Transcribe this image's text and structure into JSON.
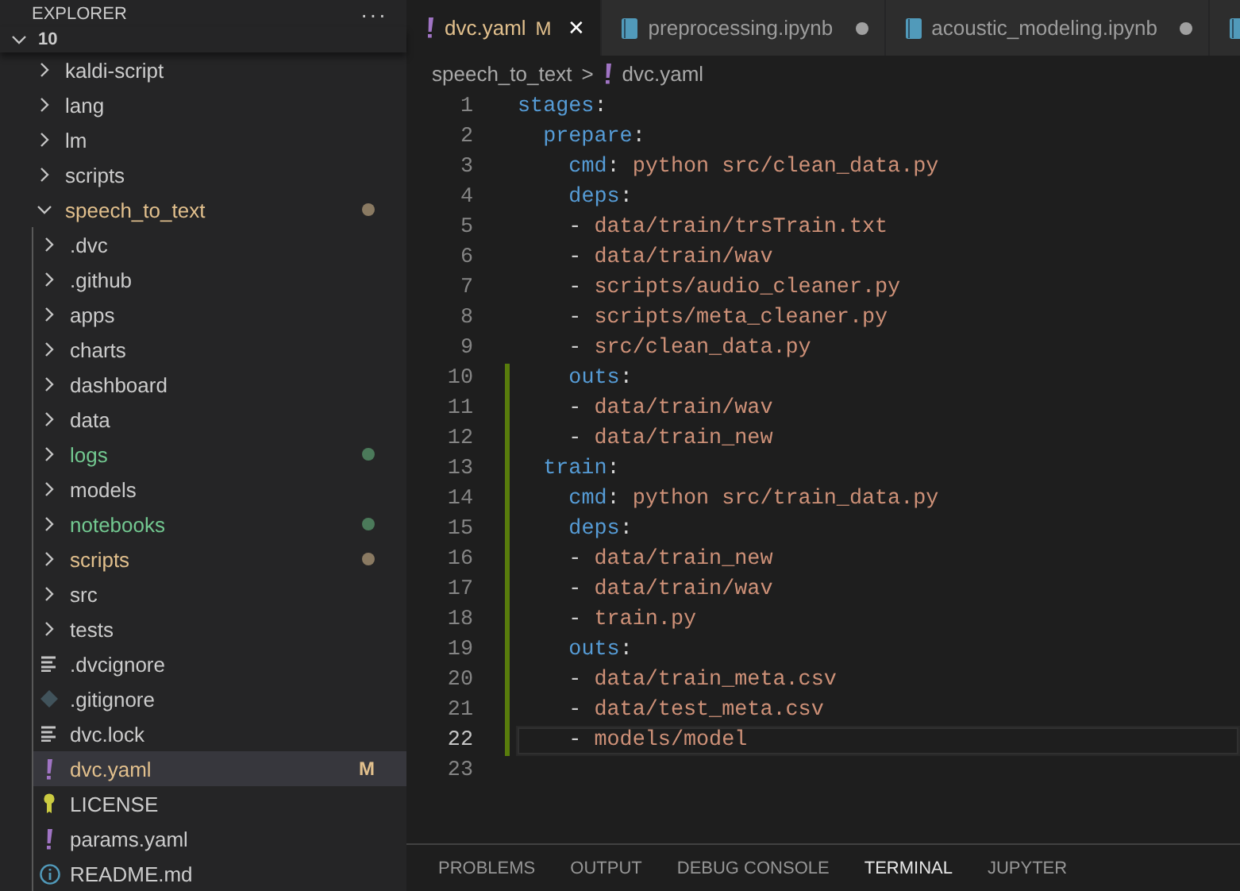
{
  "sidebar": {
    "title": "EXPLORER",
    "more": "···",
    "workspace": {
      "label": "10",
      "expanded": true
    },
    "tree": [
      {
        "name": "kaldi-script",
        "kind": "folder",
        "expanded": false,
        "modified": false,
        "untracked": false,
        "selected": false
      },
      {
        "name": "lang",
        "kind": "folder",
        "expanded": false,
        "modified": false,
        "untracked": false,
        "selected": false
      },
      {
        "name": "lm",
        "kind": "folder",
        "expanded": false,
        "modified": false,
        "untracked": false,
        "selected": false
      },
      {
        "name": "scripts",
        "kind": "folder",
        "expanded": false,
        "modified": false,
        "untracked": false,
        "selected": false
      },
      {
        "name": "speech_to_text",
        "kind": "folder",
        "expanded": true,
        "modified": true,
        "untracked": false,
        "selected": false,
        "children": [
          {
            "name": ".dvc",
            "kind": "folder",
            "expanded": false,
            "modified": false,
            "untracked": false,
            "selected": false
          },
          {
            "name": ".github",
            "kind": "folder",
            "expanded": false,
            "modified": false,
            "untracked": false,
            "selected": false
          },
          {
            "name": "apps",
            "kind": "folder",
            "expanded": false,
            "modified": false,
            "untracked": false,
            "selected": false
          },
          {
            "name": "charts",
            "kind": "folder",
            "expanded": false,
            "modified": false,
            "untracked": false,
            "selected": false
          },
          {
            "name": "dashboard",
            "kind": "folder",
            "expanded": false,
            "modified": false,
            "untracked": false,
            "selected": false
          },
          {
            "name": "data",
            "kind": "folder",
            "expanded": false,
            "modified": false,
            "untracked": false,
            "selected": false
          },
          {
            "name": "logs",
            "kind": "folder",
            "expanded": false,
            "modified": false,
            "untracked": true,
            "selected": false
          },
          {
            "name": "models",
            "kind": "folder",
            "expanded": false,
            "modified": false,
            "untracked": false,
            "selected": false
          },
          {
            "name": "notebooks",
            "kind": "folder",
            "expanded": false,
            "modified": false,
            "untracked": true,
            "selected": false
          },
          {
            "name": "scripts",
            "kind": "folder",
            "expanded": false,
            "modified": true,
            "untracked": false,
            "selected": false
          },
          {
            "name": "src",
            "kind": "folder",
            "expanded": false,
            "modified": false,
            "untracked": false,
            "selected": false
          },
          {
            "name": "tests",
            "kind": "folder",
            "expanded": false,
            "modified": false,
            "untracked": false,
            "selected": false
          },
          {
            "name": ".dvcignore",
            "kind": "text",
            "modified": false,
            "untracked": false,
            "selected": false
          },
          {
            "name": ".gitignore",
            "kind": "git",
            "modified": false,
            "untracked": false,
            "selected": false
          },
          {
            "name": "dvc.lock",
            "kind": "text",
            "modified": false,
            "untracked": false,
            "selected": false
          },
          {
            "name": "dvc.yaml",
            "kind": "yaml",
            "modified": true,
            "untracked": false,
            "badge": "M",
            "selected": true
          },
          {
            "name": "LICENSE",
            "kind": "license",
            "modified": false,
            "untracked": false,
            "selected": false
          },
          {
            "name": "params.yaml",
            "kind": "yaml",
            "modified": false,
            "untracked": false,
            "selected": false
          },
          {
            "name": "README.md",
            "kind": "info",
            "modified": false,
            "untracked": false,
            "selected": false
          }
        ]
      }
    ]
  },
  "tabs": [
    {
      "label": "dvc.yaml",
      "kind": "yaml",
      "selected": true,
      "badge": "M",
      "close": "✕",
      "dirty": false
    },
    {
      "label": "preprocessing.ipynb",
      "kind": "notebook",
      "selected": false,
      "dirty": true
    },
    {
      "label": "acoustic_modeling.ipynb",
      "kind": "notebook",
      "selected": false,
      "dirty": true
    },
    {
      "kind": "notebook",
      "selected": false,
      "dirty": false
    }
  ],
  "breadcrumb": {
    "folder": "speech_to_text",
    "separator": ">",
    "file": "dvc.yaml"
  },
  "code": [
    {
      "number": "1",
      "text": "stages:",
      "changed": false,
      "current": false
    },
    {
      "number": "2",
      "text": "  prepare:",
      "changed": false,
      "current": false
    },
    {
      "number": "3",
      "text": "    cmd: python src/clean_data.py",
      "changed": false,
      "current": false
    },
    {
      "number": "4",
      "text": "    deps:",
      "changed": false,
      "current": false
    },
    {
      "number": "5",
      "text": "    - data/train/trsTrain.txt",
      "changed": false,
      "current": false
    },
    {
      "number": "6",
      "text": "    - data/train/wav",
      "changed": false,
      "current": false
    },
    {
      "number": "7",
      "text": "    - scripts/audio_cleaner.py",
      "changed": false,
      "current": false
    },
    {
      "number": "8",
      "text": "    - scripts/meta_cleaner.py",
      "changed": false,
      "current": false
    },
    {
      "number": "9",
      "text": "    - src/clean_data.py",
      "changed": false,
      "current": false
    },
    {
      "number": "10",
      "text": "    outs:",
      "changed": true,
      "current": false
    },
    {
      "number": "11",
      "text": "    - data/train/wav",
      "changed": true,
      "current": false
    },
    {
      "number": "12",
      "text": "    - data/train_new",
      "changed": true,
      "current": false
    },
    {
      "number": "13",
      "text": "  train:",
      "changed": true,
      "current": false
    },
    {
      "number": "14",
      "text": "    cmd: python src/train_data.py",
      "changed": true,
      "current": false
    },
    {
      "number": "15",
      "text": "    deps:",
      "changed": true,
      "current": false
    },
    {
      "number": "16",
      "text": "    - data/train_new",
      "changed": true,
      "current": false
    },
    {
      "number": "17",
      "text": "    - data/train/wav",
      "changed": true,
      "current": false
    },
    {
      "number": "18",
      "text": "    - train.py",
      "changed": true,
      "current": false
    },
    {
      "number": "19",
      "text": "    outs:",
      "changed": true,
      "current": false
    },
    {
      "number": "20",
      "text": "    - data/train_meta.csv",
      "changed": true,
      "current": false
    },
    {
      "number": "21",
      "text": "    - data/test_meta.csv",
      "changed": true,
      "current": false
    },
    {
      "number": "22",
      "text": "    - models/model",
      "changed": true,
      "current": true
    },
    {
      "number": "23",
      "changed": false,
      "current": false
    }
  ],
  "panel_tabs": [
    {
      "label": "PROBLEMS",
      "selected": false
    },
    {
      "label": "OUTPUT",
      "selected": false
    },
    {
      "label": "DEBUG CONSOLE",
      "selected": false
    },
    {
      "label": "TERMINAL",
      "selected": true
    },
    {
      "label": "JUPYTER",
      "selected": false
    }
  ]
}
